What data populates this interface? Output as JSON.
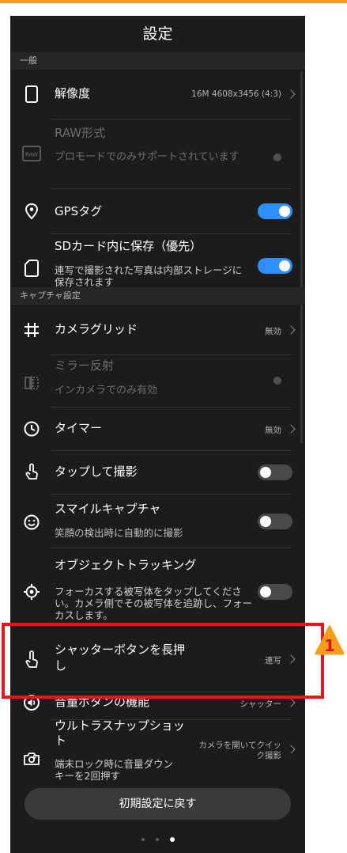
{
  "screen_title": "設定",
  "sections": {
    "general": "一般",
    "capture": "キャプチャ設定"
  },
  "rows": {
    "resolution": {
      "label": "解像度",
      "value": "16M 4608x3456 (4:3)"
    },
    "raw": {
      "label": "RAW形式",
      "sub": "プロモードでのみサポートされています",
      "enabled": false
    },
    "gps": {
      "label": "GPSタグ",
      "toggle": true
    },
    "sd": {
      "label": "SDカード内に保存（優先）",
      "sub": "連写で撮影された写真は内部ストレージに保存されます",
      "toggle": true
    },
    "grid": {
      "label": "カメラグリッド",
      "value": "無効"
    },
    "mirror": {
      "label": "ミラー反射",
      "sub": "インカメラでのみ有効",
      "enabled": false
    },
    "timer": {
      "label": "タイマー",
      "value": "無効"
    },
    "tap": {
      "label": "タップして撮影",
      "toggle": false
    },
    "smile": {
      "label": "スマイルキャプチャ",
      "sub": "笑顔の検出時に自動的に撮影",
      "toggle": false
    },
    "tracking": {
      "label": "オブジェクトトラッキング",
      "sub": "フォーカスする被写体をタップしてください。カメラ側でその被写体を追跡し、フォーカスします。",
      "toggle": false
    },
    "shutter_hold": {
      "label": "シャッターボタンを長押し",
      "value": "連写"
    },
    "volume": {
      "label": "音量ボタンの機能",
      "value": "シャッター"
    },
    "ultra": {
      "label": "ウルトラスナップショット",
      "sub": "端末ロック時に音量ダウンキーを2回押す",
      "value": "カメラを開いてクイック撮影"
    }
  },
  "reset_button": "初期設定に戻す",
  "annotation": {
    "badge": "1"
  },
  "colors": {
    "accent": "#2f8fff",
    "highlight": "#e3161a",
    "warning": "#f59c1a",
    "background": "#1c1c1c"
  }
}
